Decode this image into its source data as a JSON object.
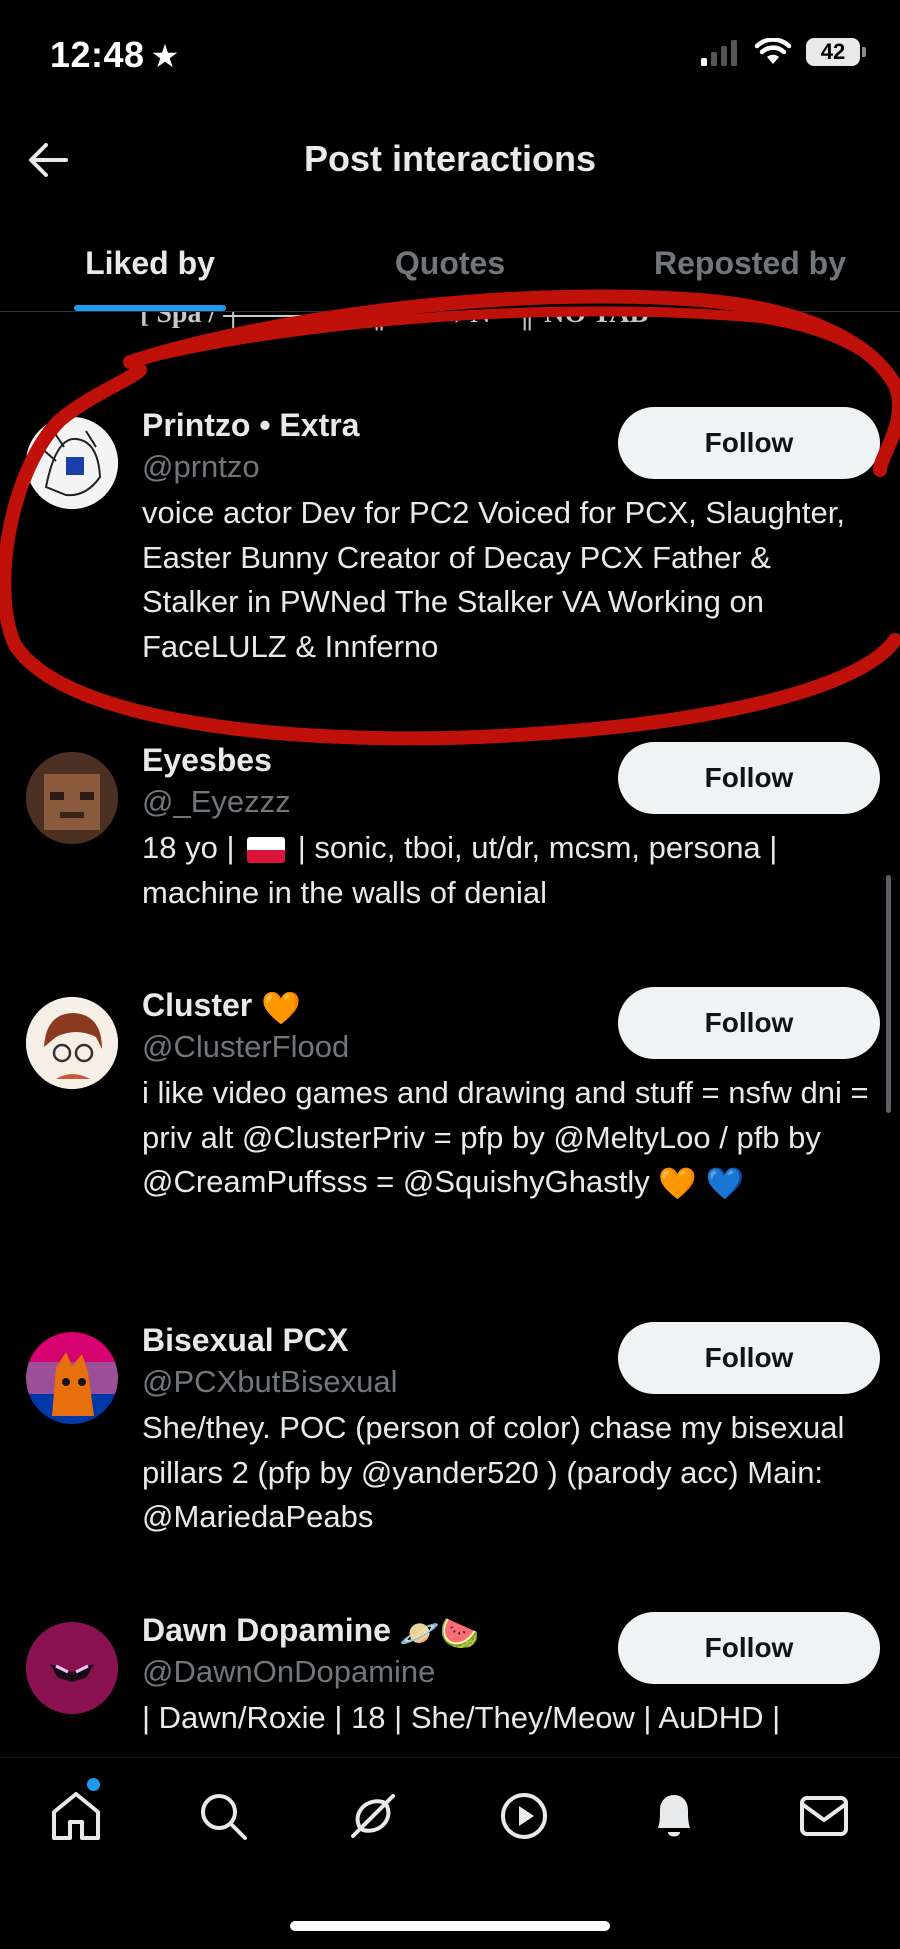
{
  "status_bar": {
    "time": "12:48",
    "battery": "42"
  },
  "header": {
    "title": "Post interactions"
  },
  "tabs": [
    {
      "label": "Liked by",
      "active": true
    },
    {
      "label": "Quotes",
      "active": false
    },
    {
      "label": "Reposted by",
      "active": false
    }
  ],
  "cutoff_text": "[ Spa / ╪═══ ═══╢═══ / N ═╢ NO TAB ═",
  "users": [
    {
      "name": "Printzo • Extra",
      "handle": "@prntzo",
      "follow_label": "Follow",
      "bio": "voice actor Dev for PC2 Voiced for PCX, Slaughter, Easter Bunny Creator of Decay PCX Father & Stalker in PWNed The Stalker VA Working on FaceLULZ & Innferno"
    },
    {
      "name": "Eyesbes",
      "handle": "@_Eyezzz",
      "follow_label": "Follow",
      "bio_a": "18 yo |",
      "bio_b": "| sonic, tboi, ut/dr, mcsm, persona | machine in the walls of denial"
    },
    {
      "name": "Cluster",
      "name_emoji": "🧡",
      "handle": "@ClusterFlood",
      "follow_label": "Follow",
      "bio": "i like video games and drawing and stuff = nsfw dni = priv alt @ClusterPriv = pfp by @MeltyLoo / pfb by @CreamPuffsss = @SquishyGhastly",
      "bio_emoji": "🧡 💙"
    },
    {
      "name": "Bisexual PCX",
      "handle": "@PCXbutBisexual",
      "follow_label": "Follow",
      "bio": "She/they. POC (person of color) chase my bisexual pillars 2 (pfp by @yander520 ) (parody acc) Main: @MariedaPeabs"
    },
    {
      "name": "Dawn Dopamine",
      "name_emoji": "🪐🍉",
      "handle": "@DawnOnDopamine",
      "follow_label": "Follow",
      "bio": "| Dawn/Roxie | 18 | She/They/Meow | AuDHD |"
    }
  ],
  "nav": [
    "home-icon",
    "search-icon",
    "grok-icon",
    "video-icon",
    "notifications-icon",
    "messages-icon"
  ],
  "colors": {
    "accent": "#1d9bf0",
    "annotation": "#c0100a",
    "background": "#000000"
  }
}
